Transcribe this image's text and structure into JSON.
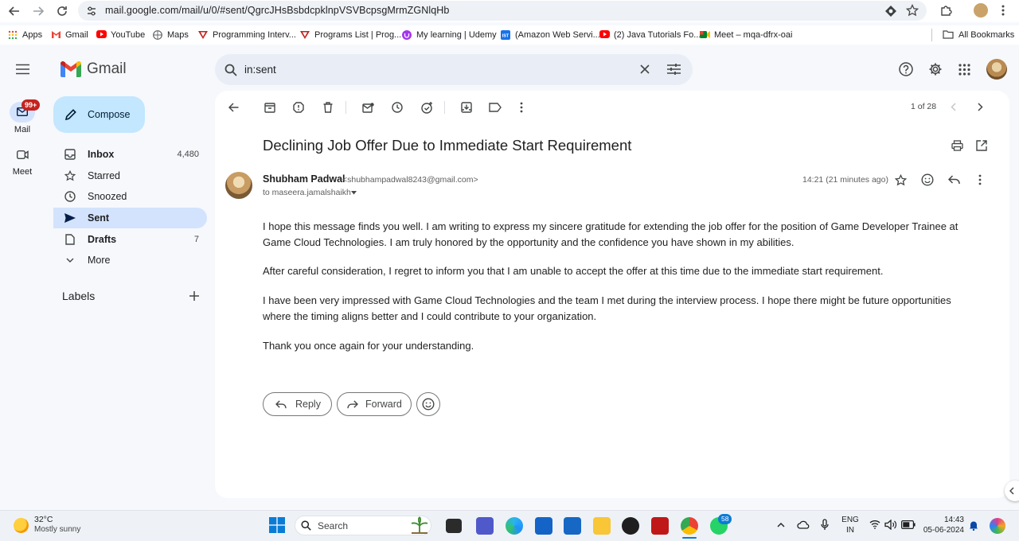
{
  "browser": {
    "url": "mail.google.com/mail/u/0/#sent/QgrcJHsBsbdcpklnpVSVBcpsgMrmZGNlqHb",
    "all_bookmarks_label": "All Bookmarks"
  },
  "bookmarks": [
    {
      "label": "Apps",
      "icon": "apps-grid-icon"
    },
    {
      "label": "Gmail",
      "icon": "gmail-icon"
    },
    {
      "label": "YouTube",
      "icon": "youtube-icon"
    },
    {
      "label": "Maps",
      "icon": "maps-icon"
    },
    {
      "label": "Programming Interv...",
      "icon": "vshape-icon"
    },
    {
      "label": "Programs List | Prog...",
      "icon": "vshape-icon"
    },
    {
      "label": "My learning | Udemy",
      "icon": "udemy-icon"
    },
    {
      "label": "(Amazon Web Servi...",
      "icon": "ist-icon"
    },
    {
      "label": "(2) Java Tutorials Fo...",
      "icon": "youtube-icon"
    },
    {
      "label": "Meet – mqa-dfrx-oai",
      "icon": "meet-icon"
    }
  ],
  "gmail": {
    "logo_text": "Gmail",
    "search_query": "in:sent",
    "rail": {
      "mail_label": "Mail",
      "mail_badge": "99+",
      "meet_label": "Meet"
    },
    "compose_label": "Compose",
    "nav": [
      {
        "label": "Inbox",
        "count": "4,480"
      },
      {
        "label": "Starred",
        "count": ""
      },
      {
        "label": "Snoozed",
        "count": ""
      },
      {
        "label": "Sent",
        "count": ""
      },
      {
        "label": "Drafts",
        "count": "7"
      },
      {
        "label": "More",
        "count": ""
      }
    ],
    "labels_heading": "Labels",
    "pagination": "1 of 28"
  },
  "email": {
    "subject": "Declining Job Offer Due to Immediate Start Requirement",
    "sender_name": "Shubham Padwal",
    "sender_email": "<shubhampadwal8243@gmail.com>",
    "to": "to maseera.jamalshaikh",
    "time": "14:21 (21 minutes ago)",
    "body": [
      "I hope this message finds you well. I am writing to express my sincere gratitude for extending the job offer for the position of Game Developer Trainee at Game Cloud Technologies. I am truly honored by the opportunity and the confidence you have shown in my abilities.",
      "After careful consideration, I regret to inform you that I am unable to accept the offer at this time due to the immediate start requirement.",
      "I have been very impressed with Game Cloud Technologies and the team I met during the interview process. I hope there might be future opportunities where the timing aligns better and I could contribute to your organization.",
      "Thank you once again for your understanding."
    ],
    "reply_label": "Reply",
    "forward_label": "Forward"
  },
  "taskbar": {
    "weather_temp": "32°C",
    "weather_desc": "Mostly sunny",
    "search_label": "Search",
    "whatsapp_badge": "58",
    "lang_line1": "ENG",
    "lang_line2": "IN",
    "clock_time": "14:43",
    "clock_date": "05-06-2024"
  },
  "colors": {
    "accent": "#0b57d0",
    "compose_bg": "#c2e7ff",
    "active_nav_bg": "#d3e3fd",
    "badge_red": "#c5221f"
  }
}
